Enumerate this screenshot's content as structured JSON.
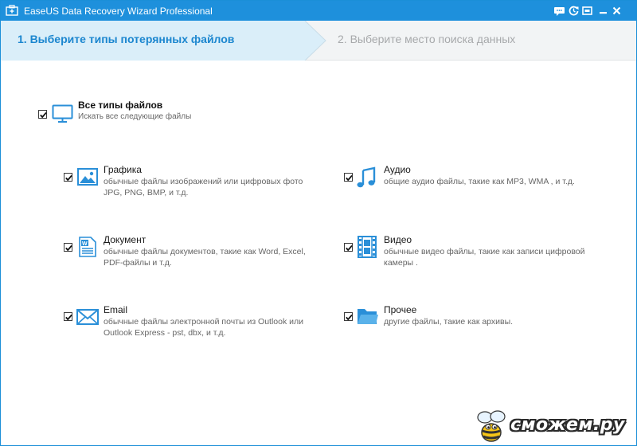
{
  "window": {
    "title": "EaseUS Data Recovery Wizard Professional"
  },
  "titlebar_icons": [
    "chat-icon",
    "refresh-icon",
    "settings-icon",
    "minimize-icon",
    "close-icon"
  ],
  "steps": {
    "step1": "1. Выберите типы потерянных файлов",
    "step2": "2. Выберите место поиска данных"
  },
  "all_types": {
    "title": "Все типы файлов",
    "desc": "Искать все следующие файлы",
    "checked": true
  },
  "file_types": {
    "graphics": {
      "title": "Графика",
      "desc": "обычные файлы изображений или цифровых фото JPG, PNG, BMP, и т.д.",
      "checked": true,
      "icon": "image-icon"
    },
    "audio": {
      "title": "Аудио",
      "desc": "общие аудио файлы, такие как MP3, WMA , и т.д.",
      "checked": true,
      "icon": "music-note-icon"
    },
    "document": {
      "title": "Документ",
      "desc": "обычные файлы документов, такие как Word, Excel, PDF-файлы и т.д.",
      "checked": true,
      "icon": "word-document-icon"
    },
    "video": {
      "title": "Видео",
      "desc": "обычные видео файлы, такие как записи цифровой камеры .",
      "checked": true,
      "icon": "film-icon"
    },
    "email": {
      "title": "Email",
      "desc": "обычные файлы электронной почты из Outlook или Outlook Express - pst, dbx, и т.д.",
      "checked": true,
      "icon": "envelope-icon"
    },
    "other": {
      "title": "Прочее",
      "desc": "другие файлы, такие как архивы.",
      "checked": true,
      "icon": "folder-icon"
    }
  },
  "watermark": {
    "text": "сможем.ру"
  },
  "colors": {
    "accent": "#1e90dc",
    "step_active": "#1b86cf",
    "step_inactive": "#a7a9ab",
    "icon_blue": "#2a8fd8"
  }
}
